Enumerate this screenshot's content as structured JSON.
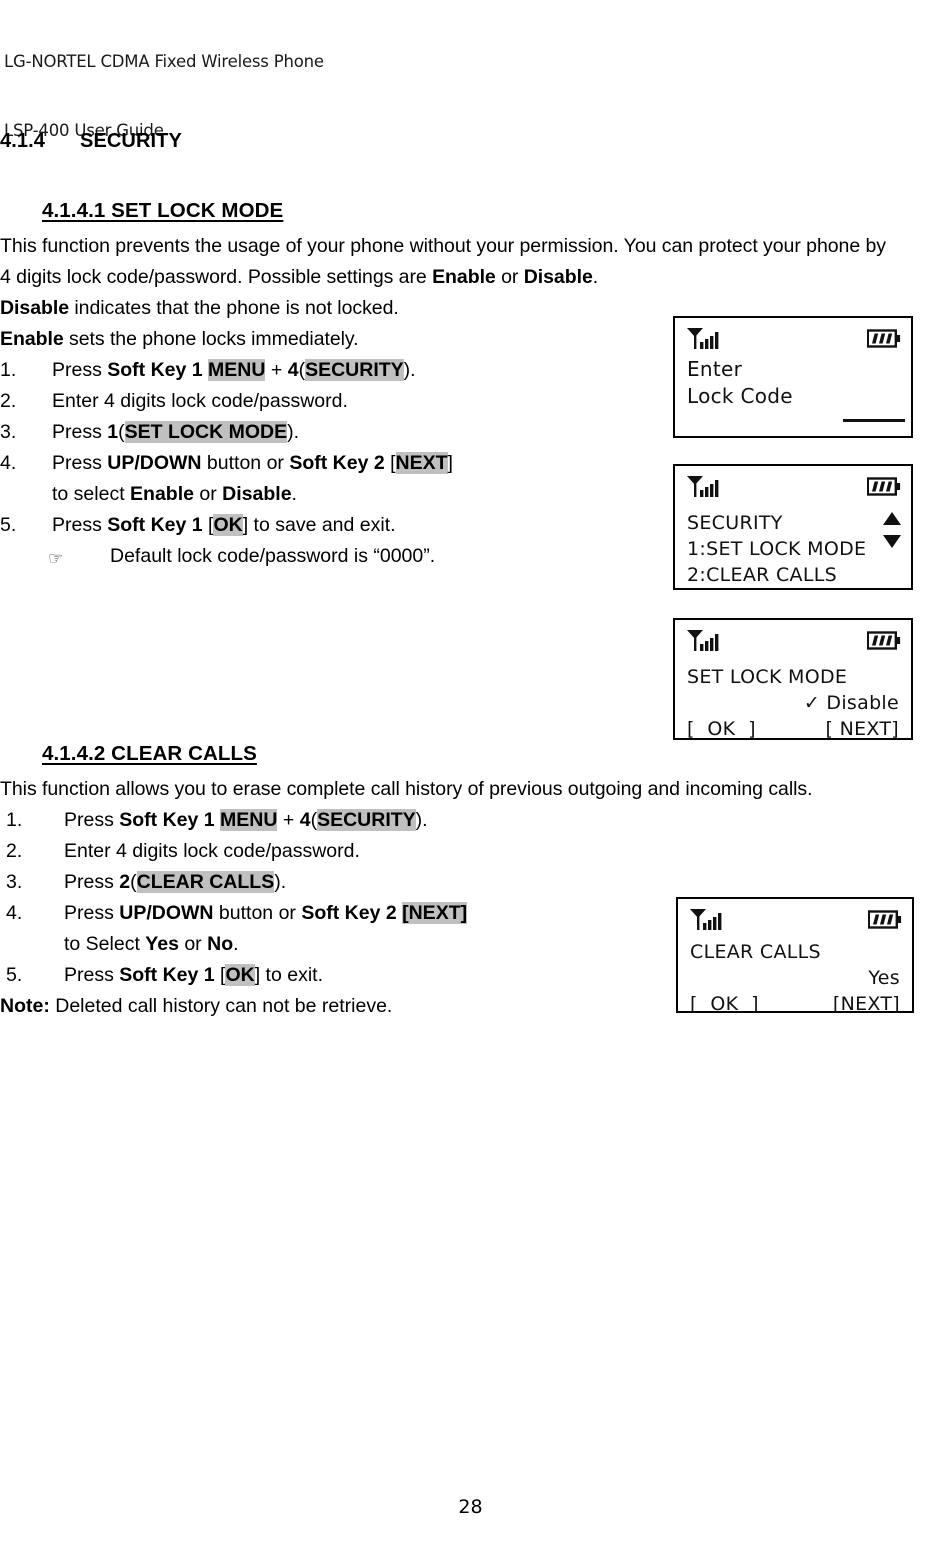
{
  "header": {
    "line1": "LG-NORTEL CDMA Fixed Wireless Phone",
    "line2": "LSP-400 User Guide"
  },
  "section": {
    "number": "4.1.4",
    "title": "SECURITY"
  },
  "subsection_1": {
    "heading": "4.1.4.1 SET LOCK MODE ",
    "paragraph": {
      "p1_a": "This function prevents the usage of your phone without your permission. You can protect your phone by 4 digits lock code/password. Possible settings are ",
      "p1_enable": "Enable",
      "p1_or": " or ",
      "p1_disable": "Disable",
      "p1_end": ".",
      "p2_disable": "Disable",
      "p2_rest": " indicates that the phone is not locked.",
      "p3_enable": "Enable",
      "p3_rest": " sets the phone locks immediately."
    },
    "steps": [
      {
        "marker": "1.",
        "parts": [
          {
            "t": "Press ",
            "b": false
          },
          {
            "t": "Soft Key 1",
            "b": true
          },
          {
            "t": " ",
            "b": false
          },
          {
            "t": "MENU",
            "b": true,
            "hl": true
          },
          {
            "t": " + ",
            "b": false
          },
          {
            "t": "4",
            "b": true
          },
          {
            "t": "(",
            "b": false
          },
          {
            "t": "SECURITY",
            "b": true,
            "hl": true
          },
          {
            "t": ").",
            "b": false
          }
        ]
      },
      {
        "marker": "2.",
        "parts": [
          {
            "t": "Enter 4 digits lock code/password.",
            "b": false
          }
        ]
      },
      {
        "marker": "3.",
        "parts": [
          {
            "t": "Press ",
            "b": false
          },
          {
            "t": "1",
            "b": true
          },
          {
            "t": "(",
            "b": false
          },
          {
            "t": "SET LOCK MODE",
            "b": true,
            "hl": true
          },
          {
            "t": ").",
            "b": false
          }
        ]
      },
      {
        "marker": "4.",
        "parts": [
          {
            "t": "Press ",
            "b": false
          },
          {
            "t": "UP/DOWN",
            "b": true
          },
          {
            "t": " button or ",
            "b": false
          },
          {
            "t": "Soft Key 2",
            "b": true
          },
          {
            "t": " [",
            "b": false
          },
          {
            "t": "NEXT",
            "b": true,
            "hl": true
          },
          {
            "t": "]",
            "b": false
          }
        ],
        "cont": [
          {
            "t": "to select ",
            "b": false
          },
          {
            "t": "Enable",
            "b": true
          },
          {
            "t": " or ",
            "b": false
          },
          {
            "t": "Disable",
            "b": true
          },
          {
            "t": ".",
            "b": false
          }
        ]
      },
      {
        "marker": "5.",
        "parts": [
          {
            "t": "Press ",
            "b": false
          },
          {
            "t": "Soft Key 1",
            "b": true
          },
          {
            "t": " [",
            "b": false
          },
          {
            "t": "OK",
            "b": true,
            "hl": true
          },
          {
            "t": "] to save and exit.",
            "b": false
          }
        ]
      }
    ],
    "hand_note": {
      "bullet_icon": "pointing-hand",
      "text": "Default lock code/password is “0000”."
    }
  },
  "subsection_2": {
    "heading": "4.1.4.2 CLEAR CALLS ",
    "paragraph": "This function allows you to erase complete call history of previous outgoing and incoming calls.",
    "steps": [
      {
        "marker": "1.",
        "parts": [
          {
            "t": "Press ",
            "b": false
          },
          {
            "t": "Soft Key 1",
            "b": true
          },
          {
            "t": " ",
            "b": false
          },
          {
            "t": "MENU",
            "b": true,
            "hl": true
          },
          {
            "t": " + ",
            "b": false
          },
          {
            "t": "4",
            "b": true
          },
          {
            "t": "(",
            "b": false
          },
          {
            "t": "SECURITY",
            "b": true,
            "hl": true
          },
          {
            "t": ").",
            "b": false
          }
        ]
      },
      {
        "marker": "2.",
        "parts": [
          {
            "t": "Enter 4 digits lock code/password.",
            "b": false
          }
        ]
      },
      {
        "marker": "3.",
        "parts": [
          {
            "t": "Press ",
            "b": false
          },
          {
            "t": "2",
            "b": true
          },
          {
            "t": "(",
            "b": false
          },
          {
            "t": "CLEAR CALLS",
            "b": true,
            "hl": true
          },
          {
            "t": ").",
            "b": false
          }
        ]
      },
      {
        "marker": "4.",
        "parts": [
          {
            "t": "Press ",
            "b": false
          },
          {
            "t": "UP/DOWN",
            "b": true
          },
          {
            "t": " button or ",
            "b": false
          },
          {
            "t": "Soft Key 2",
            "b": true
          },
          {
            "t": " ",
            "b": false
          },
          {
            "t": "[NEXT]",
            "b": true,
            "hl": true
          }
        ],
        "cont": [
          {
            "t": "to Select ",
            "b": false
          },
          {
            "t": "Yes",
            "b": true
          },
          {
            "t": " or ",
            "b": false
          },
          {
            "t": "No",
            "b": true
          },
          {
            "t": ".",
            "b": false
          }
        ]
      },
      {
        "marker": "5.",
        "parts": [
          {
            "t": "Press ",
            "b": false
          },
          {
            "t": "Soft Key 1",
            "b": true
          },
          {
            "t": " [",
            "b": false
          },
          {
            "t": "OK",
            "b": true,
            "hl": true
          },
          {
            "t": "] to exit.",
            "b": false
          }
        ]
      }
    ],
    "note": {
      "label": "Note:",
      "text": " Deleted call history can not be retrieve."
    }
  },
  "lcd_screens": [
    {
      "id": "enter-lock-code",
      "signal_icon": "signal-bars-icon",
      "battery_icon": "battery-icon",
      "lines": [
        "Enter",
        "Lock Code"
      ],
      "input_placeholder_line": true
    },
    {
      "id": "security-menu",
      "signal_icon": "signal-bars-icon",
      "battery_icon": "battery-icon",
      "lines": [
        "SECURITY",
        "1:SET LOCK MODE",
        "2:CLEAR CALLS"
      ],
      "scroll_icon": "up-down-arrows-icon"
    },
    {
      "id": "set-lock-mode",
      "signal_icon": "signal-bars-icon",
      "battery_icon": "battery-icon",
      "title": "SET LOCK MODE",
      "selected_value": "✓ Disable",
      "softkey_left": "[  OK  ]",
      "softkey_right": "[ NEXT]"
    },
    {
      "id": "clear-calls",
      "signal_icon": "signal-bars-icon",
      "battery_icon": "battery-icon",
      "title": "CLEAR CALLS",
      "selected_value": "Yes",
      "softkey_left": "[  OK  ]",
      "softkey_right": "[NEXT]"
    }
  ],
  "page_number": "28"
}
